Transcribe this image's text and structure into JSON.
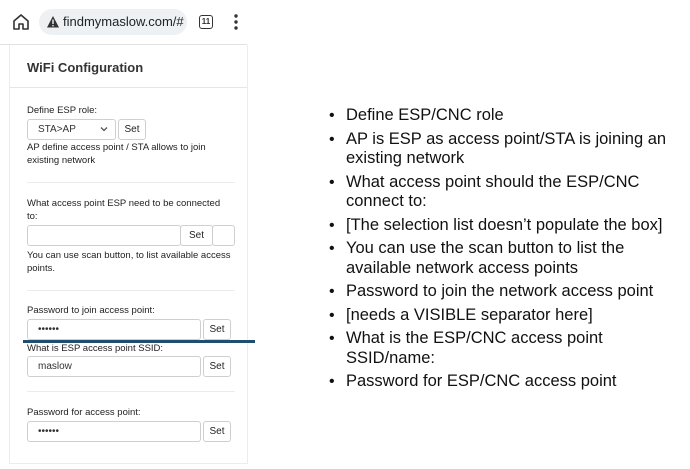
{
  "browser": {
    "url": "findmymaslow.com/#",
    "tab_count": "11"
  },
  "wifi": {
    "title": "WiFi Configuration",
    "esp_role": {
      "label": "Define ESP role:",
      "value": "STA>AP",
      "set_label": "Set",
      "help": "AP define access point / STA allows to join existing network"
    },
    "access_point": {
      "label": "What access point ESP need to be connected to:",
      "value": "",
      "set_label": "Set",
      "help": "You can use scan button, to list available access points."
    },
    "ap_password": {
      "label": "Password to join access point:",
      "value": "••••••",
      "set_label": "Set"
    },
    "esp_ssid": {
      "label": "What is ESP access point SSID:",
      "value": "maslow",
      "set_label": "Set"
    },
    "esp_password": {
      "label": "Password for access point:",
      "value": "••••••",
      "set_label": "Set"
    }
  },
  "notes": [
    "Define ESP/CNC role",
    "AP is ESP as access point/STA is joining an existing network",
    "What access point should the ESP/CNC connect to:",
    "[The selection list doesn’t populate the box]",
    "You can use the scan button to list the available network access points",
    "Password to join the network access point",
    "[needs a VISIBLE separator here]",
    "What is the ESP/CNC access point SSID/name:",
    "Password for ESP/CNC access point"
  ],
  "colors": {
    "separator_bar": "#1f4e6e"
  },
  "icons": [
    "home-icon",
    "warning-icon",
    "tabs-icon",
    "menu-icon",
    "chevron-down-icon"
  ]
}
